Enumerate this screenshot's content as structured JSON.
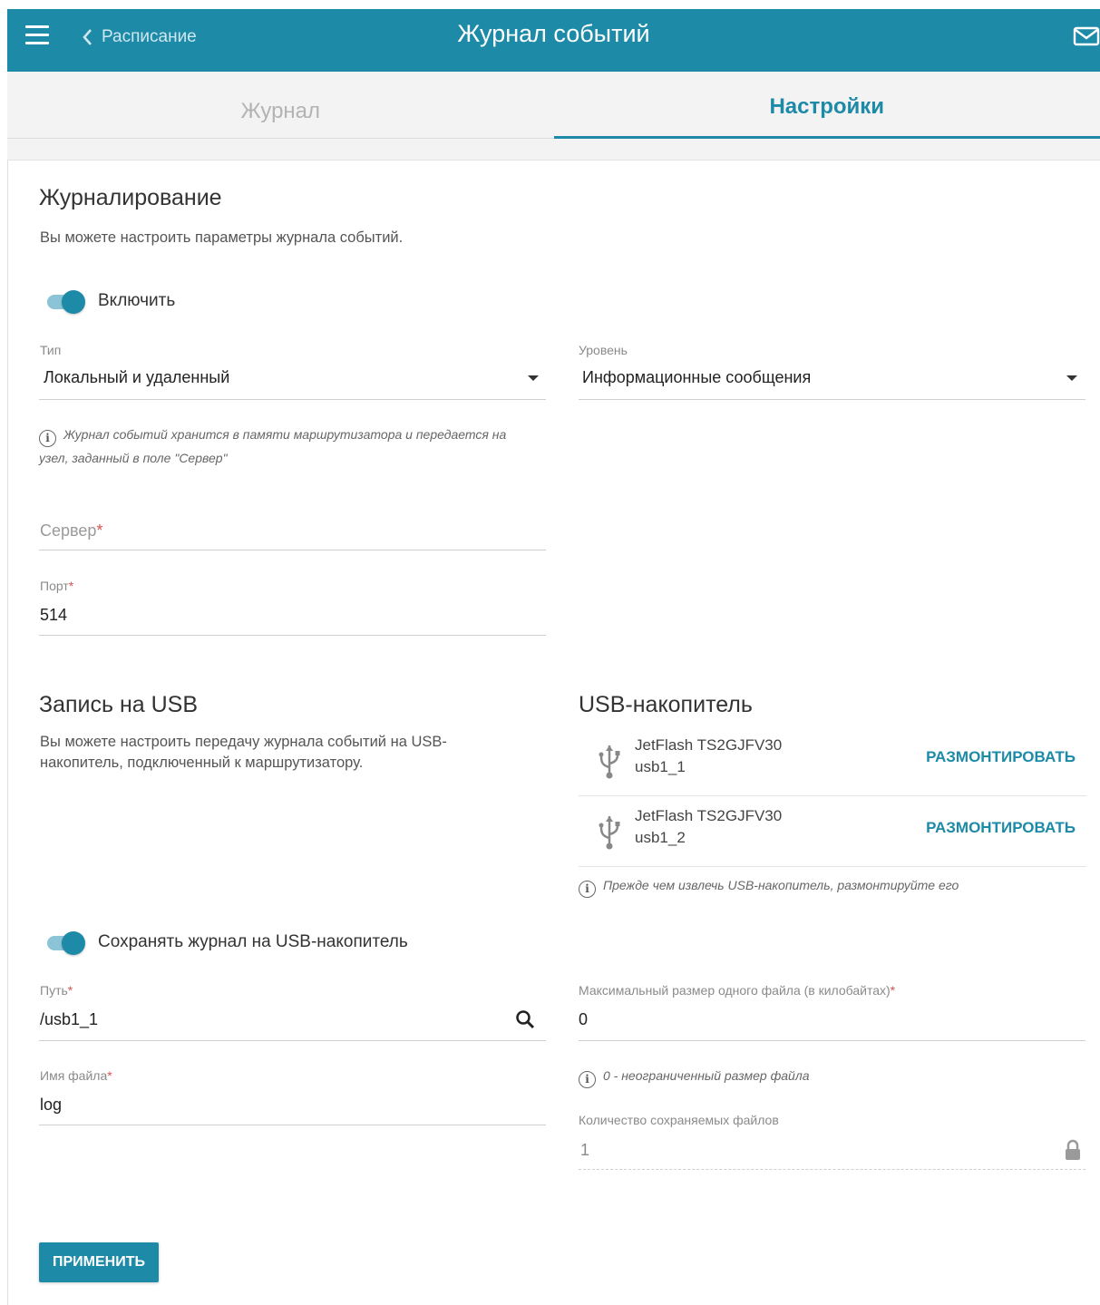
{
  "header": {
    "title": "Журнал событий",
    "back_label": "Расписание"
  },
  "tabs": [
    {
      "label": "Журнал",
      "active": false
    },
    {
      "label": "Настройки",
      "active": true
    }
  ],
  "logging": {
    "heading": "Журналирование",
    "description": "Вы можете настроить параметры журнала событий.",
    "enable_label": "Включить",
    "enable_on": true,
    "type": {
      "label": "Тип",
      "value": "Локальный и удаленный"
    },
    "level": {
      "label": "Уровень",
      "value": "Информационные сообщения"
    },
    "type_note_line1": "Журнал событий хранится в памяти маршрутизатора и передается на",
    "type_note_line2": "узел, заданный в поле \"Сервер\"",
    "server": {
      "placeholder": "Сервер",
      "value": ""
    },
    "port": {
      "label": "Порт",
      "value": "514"
    }
  },
  "usb_logging": {
    "heading": "Запись на USB",
    "description_line1": "Вы можете настроить передачу журнала событий на USB-",
    "description_line2": "накопитель, подключенный к маршрутизатору.",
    "save_label": "Сохранять журнал на USB-накопитель",
    "save_on": true,
    "path": {
      "label": "Путь",
      "value": "/usb1_1"
    },
    "filename": {
      "label": "Имя файла",
      "value": "log"
    },
    "max_size": {
      "label": "Максимальный размер одного файла (в килобайтах)",
      "value": "0"
    },
    "max_size_note": "0 - неограниченный размер файла",
    "file_count": {
      "label": "Количество сохраняемых файлов",
      "value": "1"
    }
  },
  "usb_drive": {
    "heading": "USB-накопитель",
    "devices": [
      {
        "name": "JetFlash TS2GJFV30",
        "id": "usb1_1",
        "action": "РАЗМОНТИРОВАТЬ"
      },
      {
        "name": "JetFlash TS2GJFV30",
        "id": "usb1_2",
        "action": "РАЗМОНТИРОВАТЬ"
      }
    ],
    "note": "Прежде чем извлечь USB-накопитель, размонтируйте его"
  },
  "apply_label": "ПРИМЕНИТЬ",
  "colors": {
    "accent": "#1d8aa8",
    "required": "#d9534f"
  },
  "icons": [
    "menu-icon",
    "chevron-left-icon",
    "mail-icon",
    "caret-down-icon",
    "info-icon",
    "usb-icon",
    "search-icon",
    "lock-icon"
  ]
}
